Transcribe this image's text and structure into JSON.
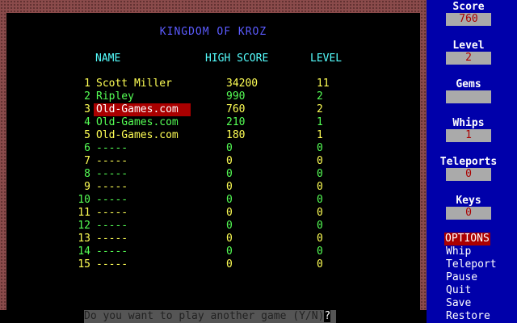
{
  "title": "KINGDOM OF KROZ",
  "headers": {
    "name": "NAME",
    "score": "HIGH SCORE",
    "level": "LEVEL"
  },
  "colors": {
    "row_odd": "#ffff55",
    "row_even": "#55ff55",
    "highlight_bg": "#aa0000"
  },
  "highlight_rank": "3",
  "scores": [
    {
      "rank": "1",
      "name": "Scott Miller",
      "score": "34200",
      "level": "11"
    },
    {
      "rank": "2",
      "name": "Ripley",
      "score": "990",
      "level": "2"
    },
    {
      "rank": "3",
      "name": "Old-Games.com",
      "score": "760",
      "level": "2"
    },
    {
      "rank": "4",
      "name": "Old-Games.com",
      "score": "210",
      "level": "1"
    },
    {
      "rank": "5",
      "name": "Old-Games.com",
      "score": "180",
      "level": "1"
    },
    {
      "rank": "6",
      "name": "-----",
      "score": "0",
      "level": "0"
    },
    {
      "rank": "7",
      "name": "-----",
      "score": "0",
      "level": "0"
    },
    {
      "rank": "8",
      "name": "-----",
      "score": "0",
      "level": "0"
    },
    {
      "rank": "9",
      "name": "-----",
      "score": "0",
      "level": "0"
    },
    {
      "rank": "10",
      "name": "-----",
      "score": "0",
      "level": "0"
    },
    {
      "rank": "11",
      "name": "-----",
      "score": "0",
      "level": "0"
    },
    {
      "rank": "12",
      "name": "-----",
      "score": "0",
      "level": "0"
    },
    {
      "rank": "13",
      "name": "-----",
      "score": "0",
      "level": "0"
    },
    {
      "rank": "14",
      "name": "-----",
      "score": "0",
      "level": "0"
    },
    {
      "rank": "15",
      "name": "-----",
      "score": "0",
      "level": "0"
    }
  ],
  "prompt": {
    "text": "Do you want to play another game (Y/N)",
    "mark": "?"
  },
  "sidebar": {
    "score_label": "Score",
    "score_value": "760",
    "level_label": "Level",
    "level_value": "2",
    "gems_label": "Gems",
    "gems_value": "",
    "whips_label": "Whips",
    "whips_value": "1",
    "teleports_label": "Teleports",
    "teleports_value": "0",
    "keys_label": "Keys",
    "keys_value": "0",
    "options_title": "OPTIONS",
    "options": [
      "Whip",
      "Teleport",
      "Pause",
      "Quit",
      "Save",
      "Restore"
    ]
  }
}
